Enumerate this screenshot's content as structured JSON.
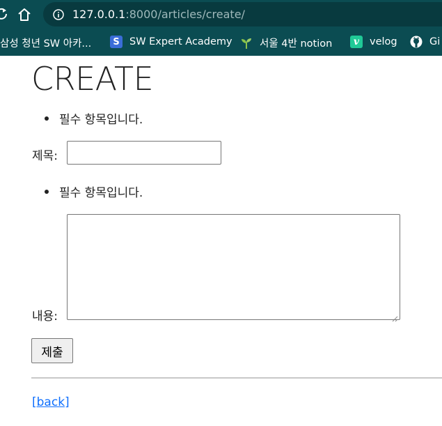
{
  "browser": {
    "url_host": "127.0.0.1",
    "url_rest": ":8000/articles/create/",
    "bookmarks": [
      {
        "label": "삼성 청년 SW 아카...",
        "icon": "samsung-icon"
      },
      {
        "label": "SW Expert Academy",
        "icon": "swea-icon"
      },
      {
        "label": "서울 4반 notion",
        "icon": "sprout-icon"
      },
      {
        "label": "velog",
        "icon": "velog-icon"
      },
      {
        "label": "Gi",
        "icon": "github-icon"
      }
    ],
    "swea_icon_text": "S",
    "velog_icon_text": "v"
  },
  "page": {
    "heading": "CREATE",
    "title_error": "필수 항목입니다.",
    "title_label": "제목:",
    "title_value": "",
    "content_error": "필수 항목입니다.",
    "content_label": "내용:",
    "content_value": "",
    "submit_label": "제출",
    "back_link": "[back]"
  },
  "colors": {
    "chrome_bg": "#0b4c52",
    "omnibox_bg": "#083a3f",
    "link": "#0d6efd"
  }
}
